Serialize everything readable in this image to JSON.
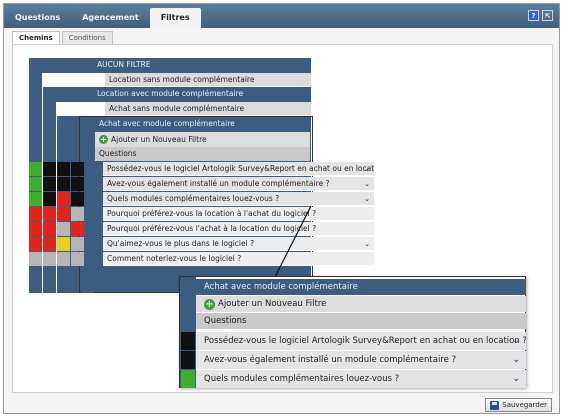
{
  "top_tabs": [
    {
      "label": "Questions"
    },
    {
      "label": "Agencement"
    },
    {
      "label": "Filtres"
    }
  ],
  "top_icons": {
    "help": "?",
    "export": "⇱"
  },
  "sub_tabs": [
    {
      "label": "Chemins"
    },
    {
      "label": "Conditions"
    }
  ],
  "filters": [
    {
      "label": "AUCUN FILTRE"
    },
    {
      "label": "Location sans module complémentaire"
    },
    {
      "label": "Location avec module complémentaire"
    },
    {
      "label": "Achat sans module complémentaire"
    },
    {
      "label": "Achat avec module complémentaire"
    }
  ],
  "add_filter_label": "Ajouter un Nouveau Filtre",
  "questions_header": "Questions",
  "questions": [
    {
      "label": "Possédez-vous le logiciel Artologik Survey&Report en achat ou en location ?",
      "dropdown": true
    },
    {
      "label": "Avez-vous également installé un module complémentaire ?",
      "dropdown": true
    },
    {
      "label": "Quels modules complémentaires louez-vous ?",
      "dropdown": true
    },
    {
      "label": "Pourquoi préférez-vous la location à l'achat du logiciel ?",
      "dropdown": false
    },
    {
      "label": "Pourquoi préférez-vous l'achat à la location du logiciel ?",
      "dropdown": false
    },
    {
      "label": "Qu'aimez-vous le plus dans le logiciel ?",
      "dropdown": true
    },
    {
      "label": "Comment noteriez-vous le logiciel ?",
      "dropdown": false
    }
  ],
  "zoom": {
    "title": "Achat avec module complémentaire",
    "add_filter_label": "Ajouter un Nouveau Filtre",
    "questions_header": "Questions",
    "rows": [
      {
        "label": "Possédez-vous le logiciel Artologik Survey&Report en achat ou en location ?"
      },
      {
        "label": "Avez-vous également installé un module complémentaire ?"
      },
      {
        "label": "Quels modules complémentaires louez-vous ?"
      }
    ]
  },
  "save_label": "Sauvegarder",
  "colors": {
    "header_blue": "#3c5d80",
    "green": "#3fae2f",
    "black": "#111111",
    "red": "#e0261c",
    "yellow": "#e3d11c",
    "gray": "#b5b5b5"
  }
}
